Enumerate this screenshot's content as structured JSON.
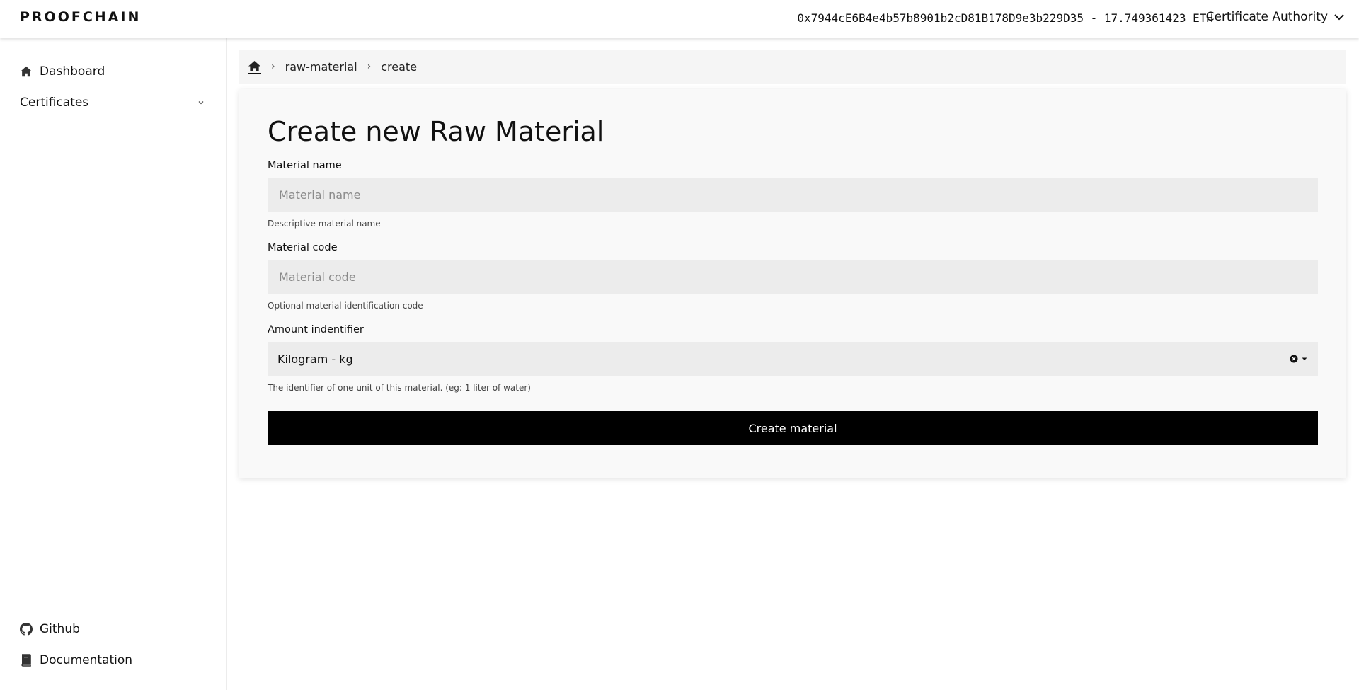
{
  "header": {
    "logo": "PROOFCHAIN",
    "wallet": "0x7944cE6B4e4b57b8901b2cD81B178D9e3b229D35 - 17.749361423 ETH",
    "role": "Certificate Authority"
  },
  "sidebar": {
    "items": [
      {
        "label": "Dashboard",
        "icon": "home-icon"
      },
      {
        "label": "Certificates",
        "icon": "chevron-down-icon"
      }
    ],
    "footer": [
      {
        "label": "Github",
        "icon": "github-icon"
      },
      {
        "label": "Documentation",
        "icon": "book-icon"
      }
    ]
  },
  "breadcrumb": {
    "home_icon": "home-icon",
    "items": [
      "raw-material",
      "create"
    ]
  },
  "form": {
    "title": "Create new Raw Material",
    "material_name": {
      "label": "Material name",
      "placeholder": "Material name",
      "value": "",
      "help": "Descriptive material name"
    },
    "material_code": {
      "label": "Material code",
      "placeholder": "Material code",
      "value": "",
      "help": "Optional material identification code"
    },
    "amount_identifier": {
      "label": "Amount indentifier",
      "value": "Kilogram - kg",
      "help": "The identifier of one unit of this material. (eg: 1 liter of water)"
    },
    "submit_label": "Create material"
  },
  "colors": {
    "button_bg": "#000000",
    "input_bg": "#ececec",
    "card_bg": "#f9f9f9"
  }
}
